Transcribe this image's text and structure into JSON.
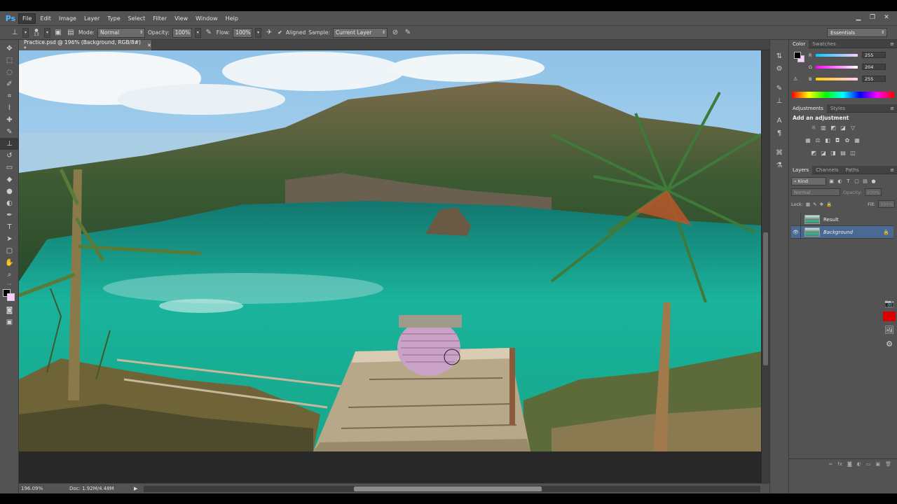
{
  "app": {
    "logo": "Ps"
  },
  "menu": [
    "File",
    "Edit",
    "Image",
    "Layer",
    "Type",
    "Select",
    "Filter",
    "View",
    "Window",
    "Help"
  ],
  "window_controls": [
    "minimize",
    "restore",
    "close"
  ],
  "options": {
    "brush_size": "13",
    "mode_label": "Mode:",
    "mode_value": "Normal",
    "opacity_label": "Opacity:",
    "opacity_value": "100%",
    "flow_label": "Flow:",
    "flow_value": "100%",
    "aligned_label": "Aligned",
    "sample_label": "Sample:",
    "sample_value": "Current Layer",
    "workspace": "Essentials"
  },
  "document": {
    "tab_title": "Practice.psd @ 196% (Background, RGB/8#) *",
    "zoom": "196.09%",
    "doc_size": "Doc: 1.92M/4.48M"
  },
  "color_panel": {
    "tabs": [
      "Color",
      "Swatches"
    ],
    "r_label": "R",
    "r_value": "255",
    "g_label": "G",
    "g_value": "204",
    "b_label": "B",
    "b_value": "255",
    "fg_color": "#000000",
    "bg_color": "#ffccff"
  },
  "adjustments_panel": {
    "tabs": [
      "Adjustments",
      "Styles"
    ],
    "title": "Add an adjustment"
  },
  "layers_panel": {
    "tabs": [
      "Layers",
      "Channels",
      "Paths"
    ],
    "kind_label": "Kind",
    "blend_mode": "Normal",
    "opacity_label": "Opacity:",
    "opacity_value": "100%",
    "lock_label": "Lock:",
    "fill_label": "Fill:",
    "fill_value": "100%",
    "layers": [
      {
        "name": "Result",
        "visible": false,
        "selected": false,
        "locked": false
      },
      {
        "name": "Background",
        "visible": true,
        "selected": true,
        "locked": true
      }
    ]
  },
  "colors": {
    "accent": "#4a6a94",
    "ui_bg": "#535353",
    "canvas_bg": "#282828"
  }
}
